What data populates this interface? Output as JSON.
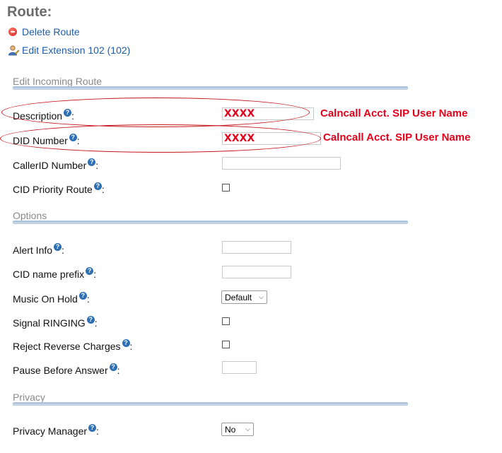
{
  "page": {
    "title": "Route:"
  },
  "actions": {
    "delete_route": "Delete Route",
    "edit_extension": "Edit Extension 102 (102)"
  },
  "sections": {
    "edit_incoming": "Edit Incoming Route",
    "options": "Options",
    "privacy": "Privacy"
  },
  "fields": {
    "description": {
      "label": "Description",
      "value": "XXXX"
    },
    "did_number": {
      "label": "DID Number",
      "value": "XXXX"
    },
    "callerid_number": {
      "label": "CallerID Number",
      "value": ""
    },
    "cid_priority_route": {
      "label": "CID Priority Route",
      "checked": false
    },
    "alert_info": {
      "label": "Alert Info",
      "value": ""
    },
    "cid_name_prefix": {
      "label": "CID name prefix",
      "value": ""
    },
    "music_on_hold": {
      "label": "Music On Hold",
      "selected": "Default"
    },
    "signal_ringing": {
      "label": "Signal RINGING",
      "checked": false
    },
    "reject_reverse_charges": {
      "label": "Reject Reverse Charges",
      "checked": false
    },
    "pause_before_answer": {
      "label": "Pause Before Answer",
      "value": ""
    },
    "privacy_manager": {
      "label": "Privacy Manager",
      "selected": "No"
    }
  },
  "annotations": {
    "description_note": "Calncall Acct. SIP User Name",
    "did_note": "Calncall Acct. SIP User Name"
  },
  "help_glyph": "?",
  "colors": {
    "link": "#1f5da8",
    "annotation_red": "#e3001b",
    "help_icon": "#2c6fb2",
    "section_text": "#8a8a8a"
  }
}
